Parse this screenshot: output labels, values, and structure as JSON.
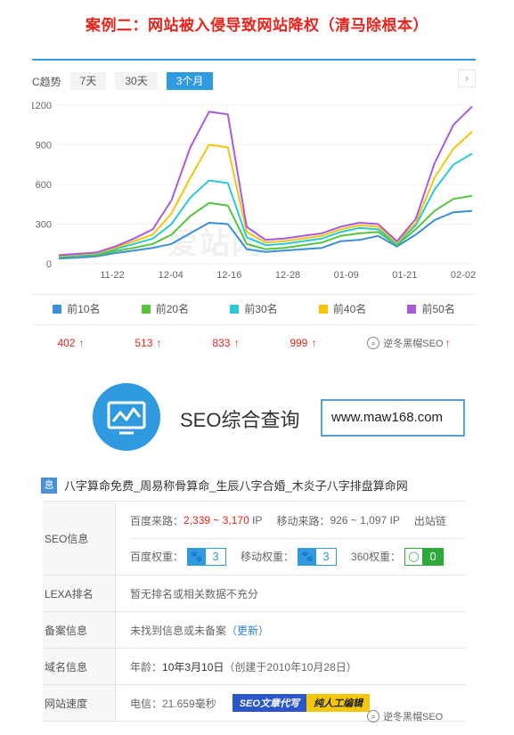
{
  "title": "案例二：网站被入侵导致网站降权（清马除根本）",
  "trend": {
    "label": "C趋势",
    "tabs": [
      "7天",
      "30天",
      "3个月"
    ],
    "active_tab": "3个月",
    "next_icon": "chevron-right-icon",
    "watermark": "爱站网"
  },
  "chart_data": {
    "type": "line",
    "x": [
      "11-22",
      "12-04",
      "12-16",
      "12-28",
      "01-09",
      "01-21",
      "02-02"
    ],
    "ylim": [
      0,
      1200
    ],
    "yticks": [
      "0",
      "300",
      "600",
      "900",
      "1200"
    ],
    "legend_position": "bottom",
    "series": [
      {
        "name": "前10名",
        "color": "#3b8fd8",
        "current": 402,
        "values": [
          40,
          45,
          55,
          80,
          100,
          120,
          150,
          230,
          310,
          300,
          110,
          90,
          100,
          110,
          120,
          170,
          180,
          210,
          130,
          220,
          330,
          390,
          400
        ]
      },
      {
        "name": "前20名",
        "color": "#55c43a",
        "current": 513,
        "values": [
          50,
          60,
          65,
          95,
          120,
          150,
          220,
          360,
          460,
          440,
          150,
          110,
          120,
          140,
          160,
          210,
          230,
          240,
          140,
          260,
          400,
          490,
          513
        ]
      },
      {
        "name": "前30名",
        "color": "#29c9d6",
        "current": 833,
        "values": [
          55,
          65,
          75,
          110,
          150,
          190,
          300,
          500,
          630,
          610,
          200,
          140,
          150,
          170,
          190,
          240,
          270,
          260,
          150,
          290,
          560,
          750,
          833
        ]
      },
      {
        "name": "前40名",
        "color": "#f5c40b",
        "current": 999,
        "values": [
          60,
          70,
          80,
          120,
          170,
          220,
          380,
          650,
          900,
          880,
          240,
          160,
          170,
          190,
          210,
          260,
          290,
          280,
          160,
          310,
          650,
          870,
          999
        ]
      },
      {
        "name": "前50名",
        "color": "#a85bdc",
        "current": 1190,
        "values": [
          65,
          75,
          85,
          130,
          190,
          260,
          480,
          880,
          1150,
          1130,
          280,
          180,
          190,
          210,
          230,
          280,
          310,
          300,
          170,
          340,
          760,
          1050,
          1190
        ]
      }
    ]
  },
  "legend": [
    {
      "label": "前10名",
      "color": "#3b8fd8"
    },
    {
      "label": "前20名",
      "color": "#55c43a"
    },
    {
      "label": "前30名",
      "color": "#29c9d6"
    },
    {
      "label": "前40名",
      "color": "#f5c40b"
    },
    {
      "label": "前50名",
      "color": "#a85bdc"
    }
  ],
  "values": [
    "402",
    "513",
    "833",
    "999"
  ],
  "wechat_watermark": "逆冬黑帽SEO",
  "seo_tool": {
    "title": "SEO综合查询",
    "input_value": "www.maw168.com"
  },
  "site": {
    "tag": "息",
    "title": "八字算命免费_周易称骨算命_生辰八字合婚_木炎子八字排盘算命网"
  },
  "table": {
    "seo_label": "SEO信息",
    "baidu_source_label": "百度来路：",
    "baidu_source_value": "2,339 ~ 3,170",
    "ip_unit": "IP",
    "mobile_source_label": "移动来路：",
    "mobile_source_value": "926 ~ 1,097",
    "outbound_label": "出站链",
    "baidu_weight_label": "百度权重：",
    "baidu_weight_value": "3",
    "mobile_weight_label": "移动权重：",
    "mobile_weight_value": "3",
    "weight360_label": "360权重：",
    "weight360_value": "0",
    "alexa_label": "LEXA排名",
    "alexa_value": "暂无排名或相关数据不充分",
    "icp_label": "备案信息",
    "icp_value": "未找到信息或未备案",
    "icp_link": "（更新）",
    "domain_label": "域名信息",
    "domain_age_label": "年龄：",
    "domain_age_value": "10年3月10日",
    "domain_created": "（创建于2010年10月28日）",
    "speed_label": "网站速度",
    "speed_value": "电信：21.659毫秒",
    "promo1": "SEO文章代写",
    "promo2": "纯人工编辑"
  }
}
